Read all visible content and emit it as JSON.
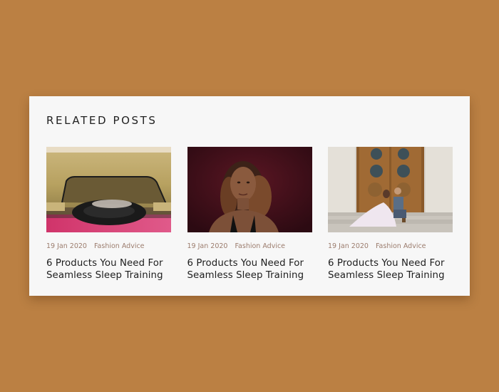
{
  "related": {
    "heading": "RELATED POSTS",
    "posts": [
      {
        "date": "19 Jan 2020",
        "category": "Fashion Advice",
        "title": "6 Products You Need For Seamless Sleep Training",
        "image": "car-wheel-photo"
      },
      {
        "date": "19 Jan 2020",
        "category": "Fashion Advice",
        "title": "6 Products You Need For Seamless Sleep Training",
        "image": "woman-portrait-photo"
      },
      {
        "date": "19 Jan 2020",
        "category": "Fashion Advice",
        "title": "6 Products You Need For Seamless Sleep Training",
        "image": "wedding-couple-door-photo"
      }
    ]
  },
  "colors": {
    "page_background": "#bb8043",
    "card_background": "#f7f7f7",
    "meta_text": "#9b7c6d",
    "title_text": "#1d1d1d"
  }
}
